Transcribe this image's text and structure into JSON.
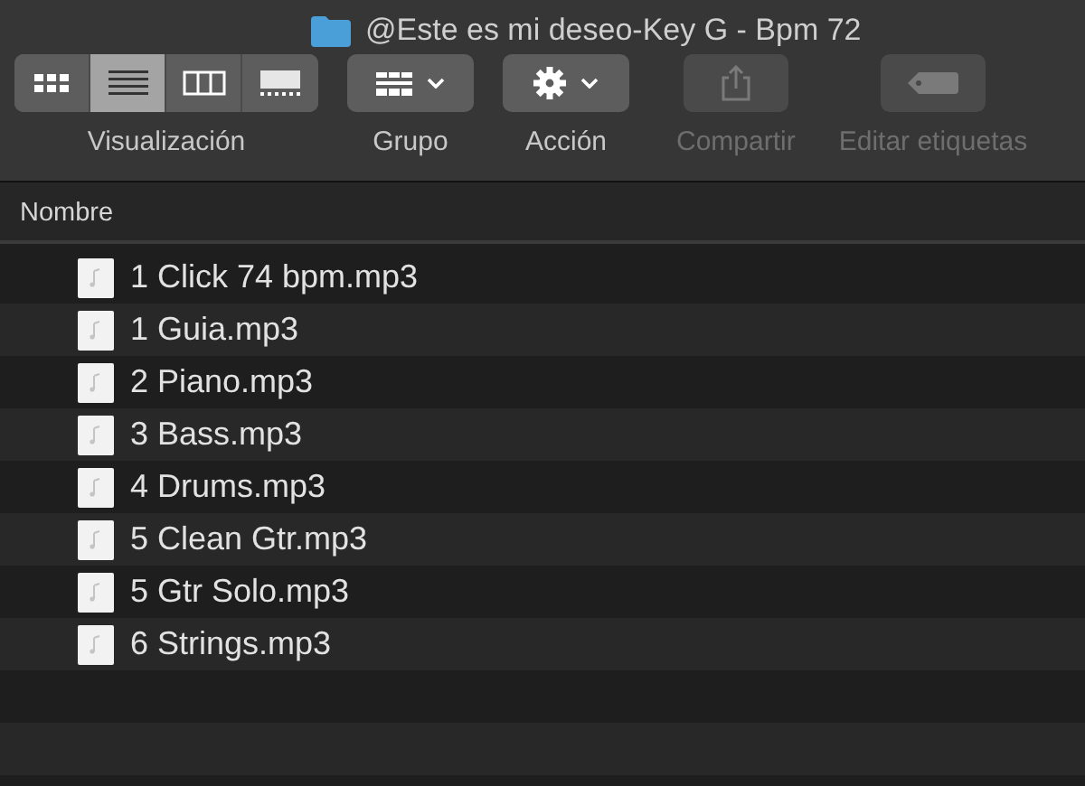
{
  "window": {
    "title": "@Este es mi deseo-Key G - Bpm 72"
  },
  "toolbar": [
    {
      "kind": "segmented",
      "label": "Visualización",
      "disabled": false,
      "segments": [
        {
          "selected": false
        },
        {
          "selected": true
        },
        {
          "selected": false
        },
        {
          "selected": false
        }
      ]
    },
    {
      "kind": "menu",
      "label": "Grupo",
      "disabled": false
    },
    {
      "kind": "menu",
      "label": "Acción",
      "disabled": false
    },
    {
      "kind": "button",
      "label": "Compartir",
      "disabled": true
    },
    {
      "kind": "button",
      "label": "Editar etiquetas",
      "disabled": true
    }
  ],
  "table": {
    "columns": [
      "Nombre"
    ],
    "rows": [
      {
        "name": "1 Click 74 bpm.mp3"
      },
      {
        "name": "1 Guia.mp3"
      },
      {
        "name": "2 Piano.mp3"
      },
      {
        "name": "3 Bass.mp3"
      },
      {
        "name": "4 Drums.mp3"
      },
      {
        "name": "5 Clean Gtr.mp3"
      },
      {
        "name": "5 Gtr Solo.mp3"
      },
      {
        "name": "6 Strings.mp3"
      }
    ]
  }
}
